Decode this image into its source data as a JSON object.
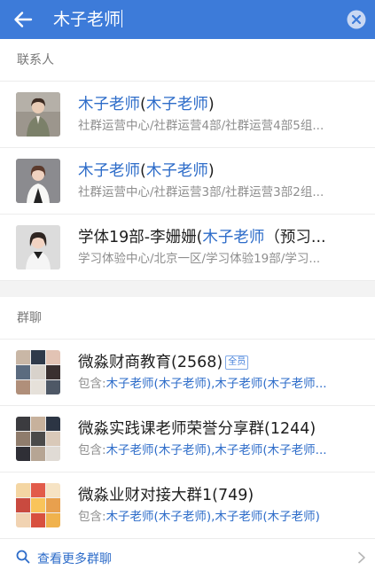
{
  "search": {
    "query": "木子老师"
  },
  "contacts_section": {
    "header": "联系人"
  },
  "contacts": [
    {
      "pre": "",
      "name": "木子老师",
      "mid": "(",
      "alias": "木子老师",
      "post": ")",
      "dept": "社群运营中心/社群运营4部/社群运营4部5组..."
    },
    {
      "pre": "",
      "name": "木子老师",
      "mid": "(",
      "alias": "木子老师",
      "post": ")",
      "dept": "社群运营中心/社群运营3部/社群运营3部2组..."
    },
    {
      "pre": "学体19部-李姗姗(",
      "name": "木子老师",
      "mid": "",
      "alias": "",
      "post": "（预习...",
      "dept": "学习体验中心/北京一区/学习体验19部/学习..."
    }
  ],
  "groups_section": {
    "header": "群聊"
  },
  "groups": [
    {
      "name": "微淼财商教育(2568)",
      "badge": "全员",
      "prefix": "包含:",
      "members": "木子老师(木子老师),木子老师(木子老师..."
    },
    {
      "name": "微淼实践课老师荣誉分享群(1244)",
      "badge": "",
      "prefix": "包含:",
      "members": "木子老师(木子老师),木子老师(木子老师..."
    },
    {
      "name": "微淼业财对接大群1(749)",
      "badge": "",
      "prefix": "包含:",
      "members": "木子老师(木子老师),木子老师(木子老师)"
    }
  ],
  "more_groups": {
    "label": "查看更多群聊"
  },
  "colors": {
    "header_bg": "#3d7bd9",
    "highlight": "#2d6cc9",
    "secondary_text": "#8e8e8e"
  },
  "icons": {
    "back": "arrow-left-icon",
    "clear": "clear-icon",
    "search": "search-icon",
    "more": "chevron-right-icon"
  }
}
